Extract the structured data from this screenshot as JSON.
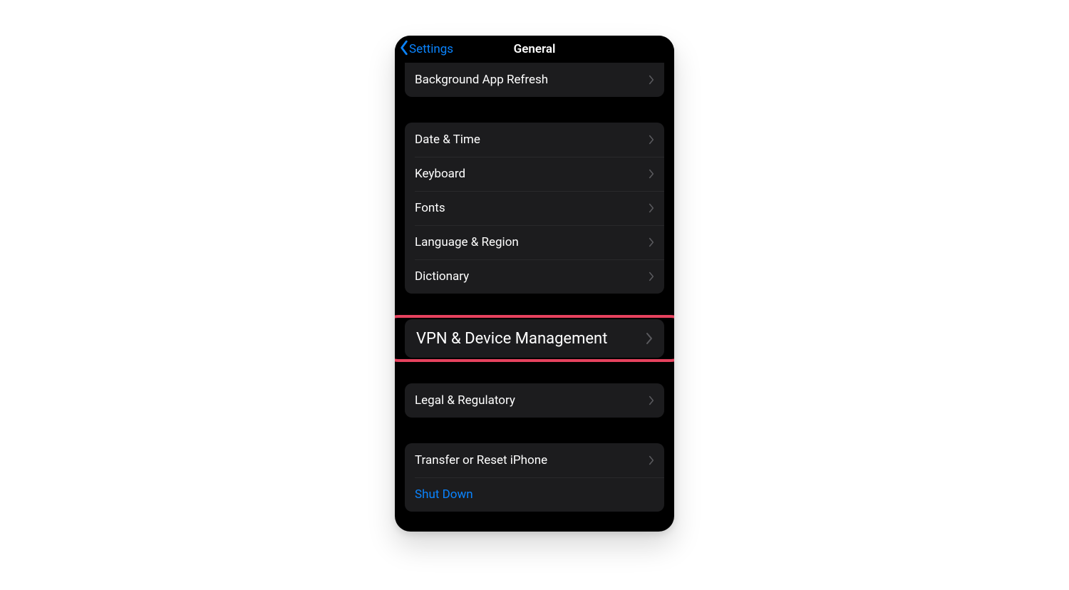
{
  "nav": {
    "back_label": "Settings",
    "title": "General"
  },
  "groups": [
    {
      "first": true,
      "rows": [
        {
          "label": "Background App Refresh",
          "chevron": true,
          "name": "row-background-app-refresh"
        }
      ]
    },
    {
      "rows": [
        {
          "label": "Date & Time",
          "chevron": true,
          "name": "row-date-time"
        },
        {
          "label": "Keyboard",
          "chevron": true,
          "name": "row-keyboard"
        },
        {
          "label": "Fonts",
          "chevron": true,
          "name": "row-fonts"
        },
        {
          "label": "Language & Region",
          "chevron": true,
          "name": "row-language-region"
        },
        {
          "label": "Dictionary",
          "chevron": true,
          "name": "row-dictionary"
        }
      ]
    },
    {
      "highlight": true,
      "rows": [
        {
          "label": "VPN & Device Management",
          "chevron": true,
          "big": true,
          "name": "row-vpn-device-management"
        }
      ]
    },
    {
      "rows": [
        {
          "label": "Legal & Regulatory",
          "chevron": true,
          "name": "row-legal-regulatory"
        }
      ]
    },
    {
      "rows": [
        {
          "label": "Transfer or Reset iPhone",
          "chevron": true,
          "name": "row-transfer-reset"
        },
        {
          "label": "Shut Down",
          "chevron": false,
          "link": true,
          "name": "row-shut-down"
        }
      ]
    }
  ]
}
